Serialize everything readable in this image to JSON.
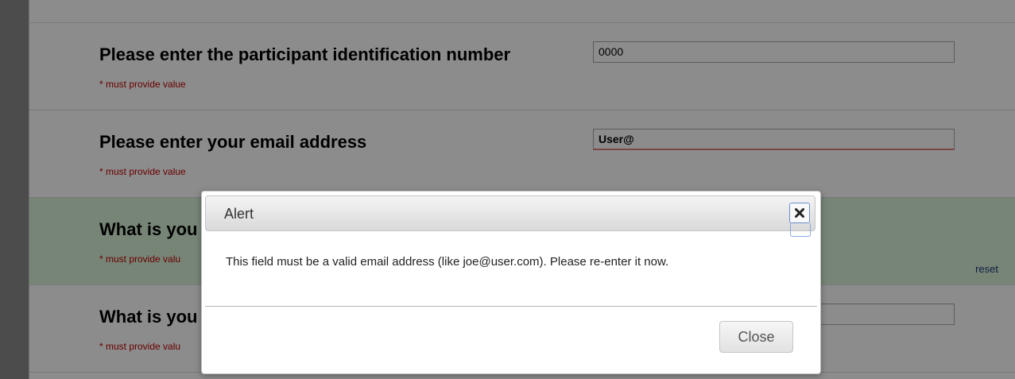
{
  "form": {
    "rows": [
      {
        "label": "Please enter the participant identification number",
        "required": "* must provide value",
        "value": "0000"
      },
      {
        "label": "Please enter your email address",
        "required": "* must provide value",
        "value": "User@"
      },
      {
        "label": "What is you",
        "required": "* must provide valu",
        "reset": "reset"
      },
      {
        "label": "What is you",
        "required": "* must provide valu",
        "value": ""
      }
    ]
  },
  "dialog": {
    "title": "Alert",
    "message": "This field must be a valid email address (like joe@user.com). Please re-enter it now.",
    "close_button": "Close",
    "close_icon": "close-icon"
  },
  "colors": {
    "required_text": "#c00000",
    "highlight_row": "#d9f2d9",
    "overlay": "rgba(0,0,0,0.45)",
    "reset_link": "#1a3a7a"
  }
}
